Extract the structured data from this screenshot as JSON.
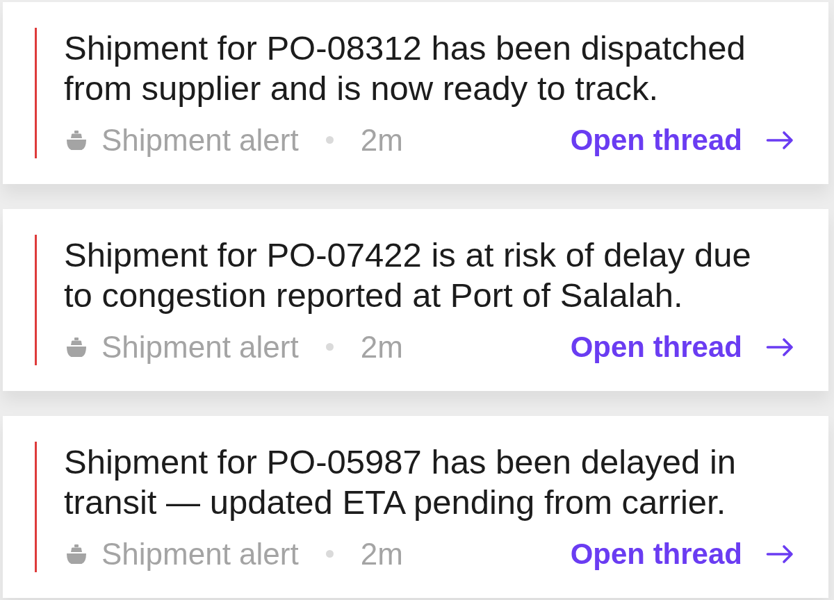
{
  "notifications": [
    {
      "message": "Shipment for PO-08312 has been dispatched from supplier and is now ready to track.",
      "category": "Shipment alert",
      "time": "2m",
      "action": "Open thread"
    },
    {
      "message": "Shipment for PO-07422 is at risk of delay due to congestion reported at Port of Salalah.",
      "category": "Shipment alert",
      "time": "2m",
      "action": "Open thread"
    },
    {
      "message": "Shipment for PO-05987 has been delayed in transit — updated ETA pending from carrier.",
      "category": "Shipment alert",
      "time": "2m",
      "action": "Open thread"
    }
  ]
}
